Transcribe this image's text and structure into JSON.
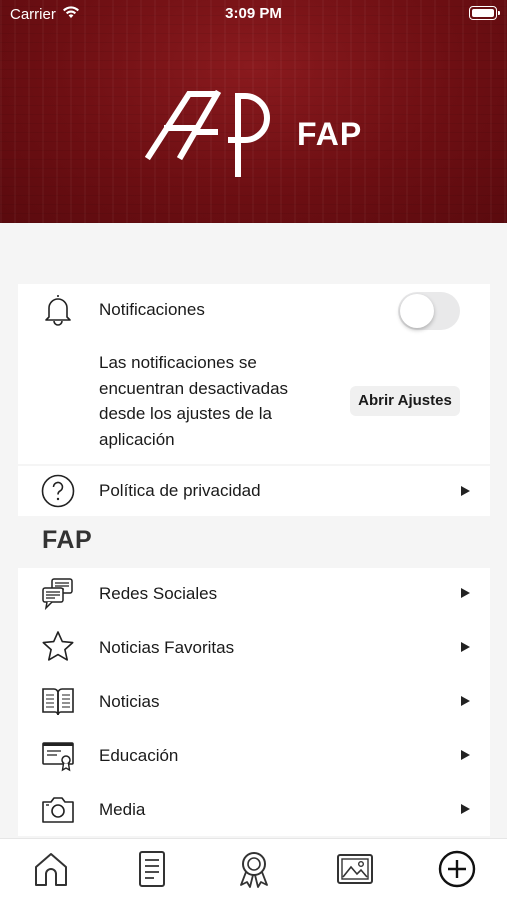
{
  "status_bar": {
    "carrier": "Carrier",
    "time": "3:09 PM"
  },
  "header": {
    "logo_text": "FAP",
    "background_color": "#6e0f13"
  },
  "notifications": {
    "label": "Notificaciones",
    "toggle_on": false,
    "message": "Las notificaciones se encuentran desactivadas desde los ajustes de la aplicación",
    "open_settings_label": "Abrir Ajustes"
  },
  "privacy": {
    "label": "Política de privacidad"
  },
  "section": {
    "title": "FAP"
  },
  "menu": [
    {
      "label": "Redes Sociales",
      "icon": "chat-bubbles-icon"
    },
    {
      "label": "Noticias Favoritas",
      "icon": "star-icon"
    },
    {
      "label": "Noticias",
      "icon": "open-book-icon"
    },
    {
      "label": "Educación",
      "icon": "certificate-icon"
    },
    {
      "label": "Media",
      "icon": "camera-icon"
    }
  ],
  "tab_bar": [
    "home-icon",
    "document-icon",
    "award-icon",
    "image-icon",
    "add-circle-icon"
  ]
}
